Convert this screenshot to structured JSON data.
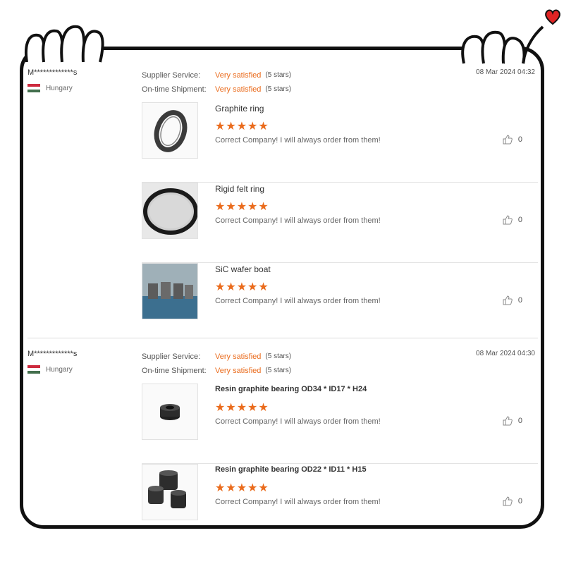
{
  "reviews": [
    {
      "user": "M*************s",
      "country": "Hungary",
      "supplier_service_label": "Supplier Service:",
      "supplier_service_value": "Very satisfied",
      "supplier_service_stars": "(5 stars)",
      "shipment_label": "On-time Shipment:",
      "shipment_value": "Very satisfied",
      "shipment_stars": "(5 stars)",
      "date": "08 Mar 2024 04:32",
      "products": [
        {
          "name": "Graphite ring",
          "rating": 5,
          "comment": "Correct Company! I will always order from them!",
          "likes": "0"
        },
        {
          "name": "Rigid felt ring",
          "rating": 5,
          "comment": "Correct Company! I will always order from them!",
          "likes": "0"
        },
        {
          "name": "SiC wafer boat",
          "rating": 5,
          "comment": "Correct Company! I will always order from them!",
          "likes": "0"
        }
      ]
    },
    {
      "user": "M*************s",
      "country": "Hungary",
      "supplier_service_label": "Supplier Service:",
      "supplier_service_value": "Very satisfied",
      "supplier_service_stars": "(5 stars)",
      "shipment_label": "On-time Shipment:",
      "shipment_value": "Very satisfied",
      "shipment_stars": "(5 stars)",
      "date": "08 Mar 2024 04:30",
      "products": [
        {
          "name": "Resin graphite bearing OD34 * ID17 * H24",
          "rating": 5,
          "comment": "Correct Company! I will always order from them!",
          "likes": "0"
        },
        {
          "name": "Resin graphite bearing OD22 * ID11 * H15",
          "rating": 5,
          "comment": "Correct Company! I will always order from them!",
          "likes": "0"
        }
      ]
    }
  ],
  "colors": {
    "accent": "#ea6b1c",
    "flag_red": "#cd2a3e",
    "flag_white": "#ffffff",
    "flag_green": "#436f4d"
  },
  "icons": {
    "like": "thumbs-up-icon",
    "star": "star-icon",
    "heart": "heart-icon"
  }
}
